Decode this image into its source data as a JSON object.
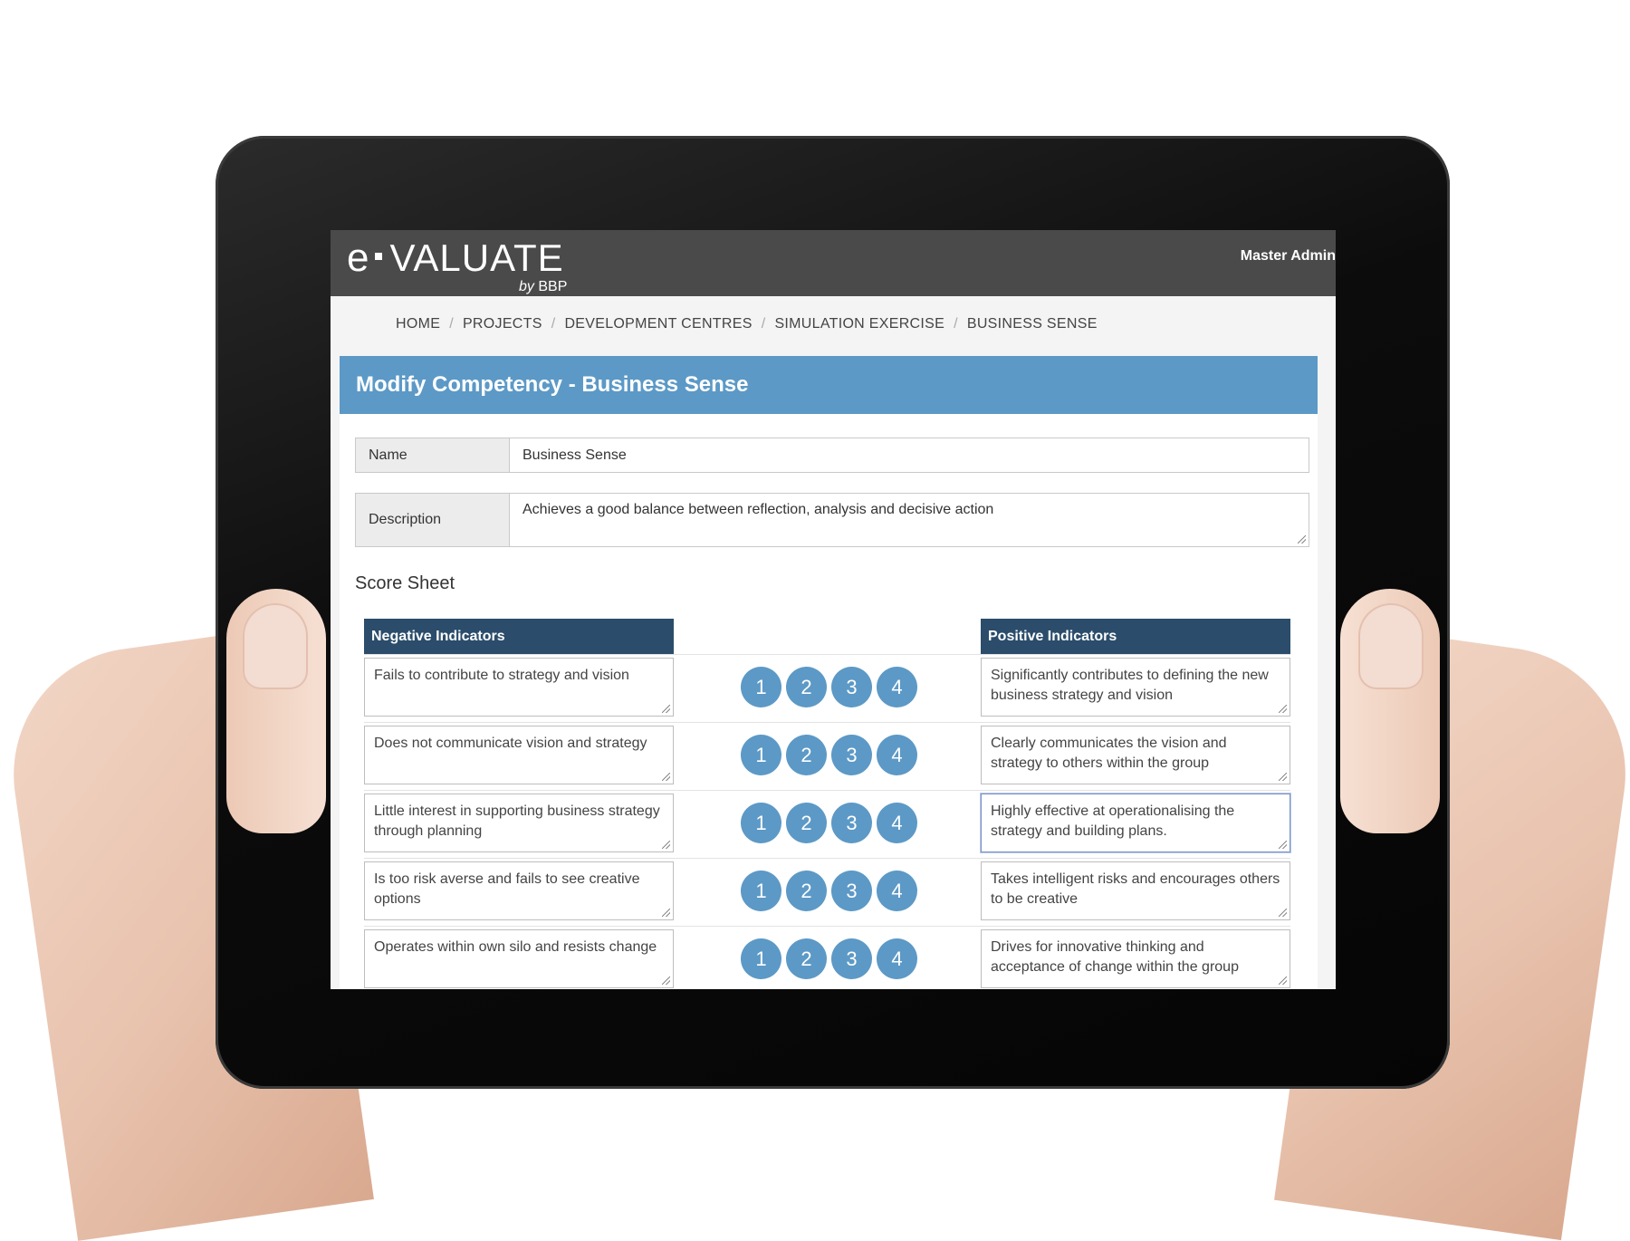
{
  "app": {
    "logo_e": "e",
    "logo_main": "VALUATE",
    "logo_by": "by",
    "logo_brand": "BBP",
    "user": "Master Admin"
  },
  "breadcrumb": [
    "HOME",
    "PROJECTS",
    "DEVELOPMENT CENTRES",
    "SIMULATION EXERCISE",
    "BUSINESS SENSE"
  ],
  "panel": {
    "title": "Modify Competency - Business Sense",
    "name_label": "Name",
    "name_value": "Business Sense",
    "description_label": "Description",
    "description_value": "Achieves a good balance between reflection, analysis and decisive action"
  },
  "score_sheet": {
    "title": "Score Sheet",
    "negative_header": "Negative Indicators",
    "positive_header": "Positive Indicators",
    "score_labels": [
      "1",
      "2",
      "3",
      "4"
    ],
    "rows": [
      {
        "negative": "Fails to contribute to strategy and vision",
        "positive": "Significantly contributes to defining the new business strategy and vision"
      },
      {
        "negative": "Does not communicate vision and strategy",
        "positive": "Clearly communicates the vision and strategy to others within the group"
      },
      {
        "negative": "Little interest in supporting business strategy through planning",
        "positive": "Highly effective at operationalising the strategy and building plans."
      },
      {
        "negative": "Is too risk averse and fails to see creative options",
        "positive": "Takes intelligent risks and encourages others to be creative"
      },
      {
        "negative": "Operates within own silo and resists change",
        "positive": "Drives for innovative thinking and acceptance of change within the group"
      }
    ]
  },
  "colors": {
    "header_bg": "#4a4a4a",
    "title_bar": "#5c99c6",
    "indicator_header": "#2b4d6b",
    "score_button": "#5c99c6"
  }
}
